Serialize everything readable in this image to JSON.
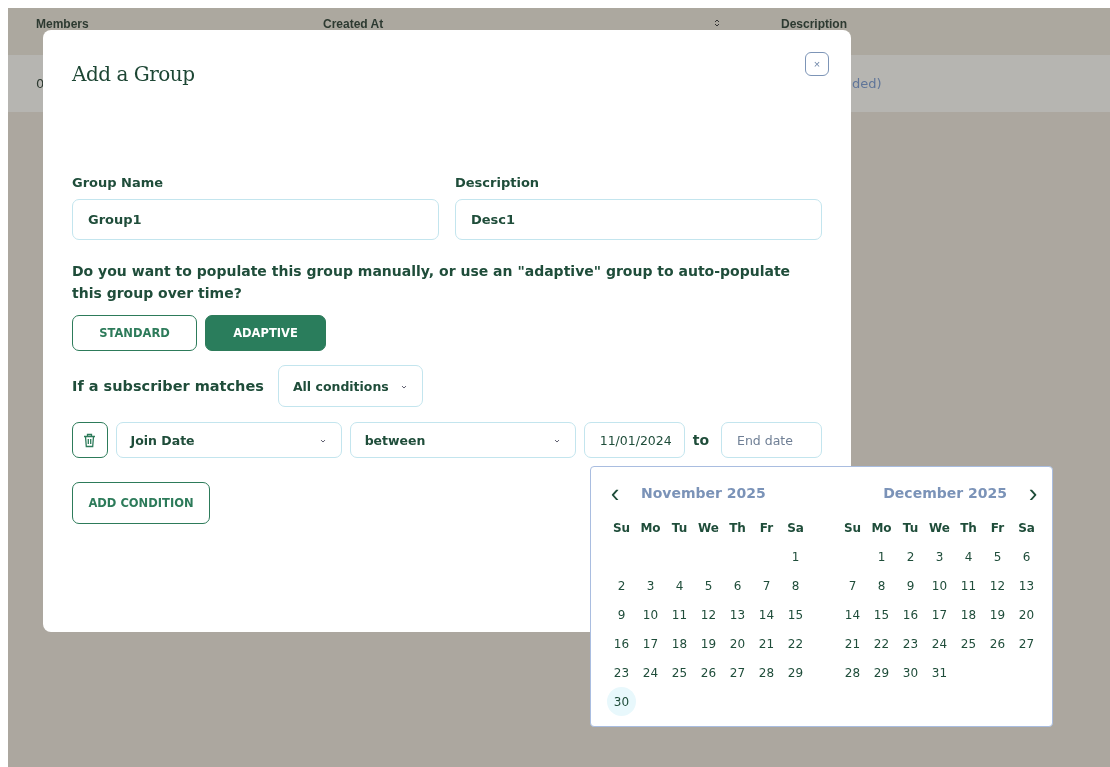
{
  "background_table": {
    "columns": [
      {
        "label": "Members"
      },
      {
        "label": "Created At",
        "sortable": true
      },
      {
        "label": "Description"
      }
    ],
    "row": {
      "first_cell": "0",
      "description_cell": "ded)"
    }
  },
  "dialog": {
    "title": "Add a Group",
    "close_label": "×",
    "fields": [
      {
        "label": "Group Name",
        "value": "Group1"
      },
      {
        "label": "Description",
        "value": "Desc1"
      }
    ],
    "question": "Do you want to populate this group manually, or use an \"adaptive\" group to auto-populate this group over time?",
    "mode_buttons": [
      {
        "label": "STANDARD",
        "selected": false
      },
      {
        "label": "ADAPTIVE",
        "selected": true
      }
    ],
    "match": {
      "label": "If a subscriber matches",
      "value": "All conditions"
    },
    "condition": {
      "field": "Join Date",
      "operator": "between",
      "start_date": "11/01/2024",
      "separator": "to",
      "end_placeholder": "End date"
    },
    "add_button": "ADD CONDITION"
  },
  "date_picker": {
    "prev_label": "‹",
    "next_label": "›",
    "months": [
      {
        "title": "November 2025",
        "weekdays": [
          "Su",
          "Mo",
          "Tu",
          "We",
          "Th",
          "Fr",
          "Sa"
        ],
        "cells": [
          {
            "kind": "blank"
          },
          {
            "kind": "blank"
          },
          {
            "kind": "blank"
          },
          {
            "kind": "blank"
          },
          {
            "kind": "blank"
          },
          {
            "kind": "blank"
          },
          {
            "kind": "day",
            "day": "1",
            "highlighted": false
          },
          {
            "kind": "day",
            "day": "2",
            "highlighted": false
          },
          {
            "kind": "day",
            "day": "3",
            "highlighted": false
          },
          {
            "kind": "day",
            "day": "4",
            "highlighted": false
          },
          {
            "kind": "day",
            "day": "5",
            "highlighted": false
          },
          {
            "kind": "day",
            "day": "6",
            "highlighted": false
          },
          {
            "kind": "day",
            "day": "7",
            "highlighted": false
          },
          {
            "kind": "day",
            "day": "8",
            "highlighted": false
          },
          {
            "kind": "day",
            "day": "9",
            "highlighted": false
          },
          {
            "kind": "day",
            "day": "10",
            "highlighted": false
          },
          {
            "kind": "day",
            "day": "11",
            "highlighted": false
          },
          {
            "kind": "day",
            "day": "12",
            "highlighted": false
          },
          {
            "kind": "day",
            "day": "13",
            "highlighted": false
          },
          {
            "kind": "day",
            "day": "14",
            "highlighted": false
          },
          {
            "kind": "day",
            "day": "15",
            "highlighted": false
          },
          {
            "kind": "day",
            "day": "16",
            "highlighted": false
          },
          {
            "kind": "day",
            "day": "17",
            "highlighted": false
          },
          {
            "kind": "day",
            "day": "18",
            "highlighted": false
          },
          {
            "kind": "day",
            "day": "19",
            "highlighted": false
          },
          {
            "kind": "day",
            "day": "20",
            "highlighted": false
          },
          {
            "kind": "day",
            "day": "21",
            "highlighted": false
          },
          {
            "kind": "day",
            "day": "22",
            "highlighted": false
          },
          {
            "kind": "day",
            "day": "23",
            "highlighted": false
          },
          {
            "kind": "day",
            "day": "24",
            "highlighted": false
          },
          {
            "kind": "day",
            "day": "25",
            "highlighted": false
          },
          {
            "kind": "day",
            "day": "26",
            "highlighted": false
          },
          {
            "kind": "day",
            "day": "27",
            "highlighted": false
          },
          {
            "kind": "day",
            "day": "28",
            "highlighted": false
          },
          {
            "kind": "day",
            "day": "29",
            "highlighted": false
          },
          {
            "kind": "day",
            "day": "30",
            "highlighted": true
          }
        ]
      },
      {
        "title": "December 2025",
        "weekdays": [
          "Su",
          "Mo",
          "Tu",
          "We",
          "Th",
          "Fr",
          "Sa"
        ],
        "cells": [
          {
            "kind": "blank"
          },
          {
            "kind": "day",
            "day": "1",
            "highlighted": false
          },
          {
            "kind": "day",
            "day": "2",
            "highlighted": false
          },
          {
            "kind": "day",
            "day": "3",
            "highlighted": false
          },
          {
            "kind": "day",
            "day": "4",
            "highlighted": false
          },
          {
            "kind": "day",
            "day": "5",
            "highlighted": false
          },
          {
            "kind": "day",
            "day": "6",
            "highlighted": false
          },
          {
            "kind": "day",
            "day": "7",
            "highlighted": false
          },
          {
            "kind": "day",
            "day": "8",
            "highlighted": false
          },
          {
            "kind": "day",
            "day": "9",
            "highlighted": false
          },
          {
            "kind": "day",
            "day": "10",
            "highlighted": false
          },
          {
            "kind": "day",
            "day": "11",
            "highlighted": false
          },
          {
            "kind": "day",
            "day": "12",
            "highlighted": false
          },
          {
            "kind": "day",
            "day": "13",
            "highlighted": false
          },
          {
            "kind": "day",
            "day": "14",
            "highlighted": false
          },
          {
            "kind": "day",
            "day": "15",
            "highlighted": false
          },
          {
            "kind": "day",
            "day": "16",
            "highlighted": false
          },
          {
            "kind": "day",
            "day": "17",
            "highlighted": false
          },
          {
            "kind": "day",
            "day": "18",
            "highlighted": false
          },
          {
            "kind": "day",
            "day": "19",
            "highlighted": false
          },
          {
            "kind": "day",
            "day": "20",
            "highlighted": false
          },
          {
            "kind": "day",
            "day": "21",
            "highlighted": false
          },
          {
            "kind": "day",
            "day": "22",
            "highlighted": false
          },
          {
            "kind": "day",
            "day": "23",
            "highlighted": false
          },
          {
            "kind": "day",
            "day": "24",
            "highlighted": false
          },
          {
            "kind": "day",
            "day": "25",
            "highlighted": false
          },
          {
            "kind": "day",
            "day": "26",
            "highlighted": false
          },
          {
            "kind": "day",
            "day": "27",
            "highlighted": false
          },
          {
            "kind": "day",
            "day": "28",
            "highlighted": false
          },
          {
            "kind": "day",
            "day": "29",
            "highlighted": false
          },
          {
            "kind": "day",
            "day": "30",
            "highlighted": false
          },
          {
            "kind": "day",
            "day": "31",
            "highlighted": false
          }
        ]
      }
    ]
  }
}
